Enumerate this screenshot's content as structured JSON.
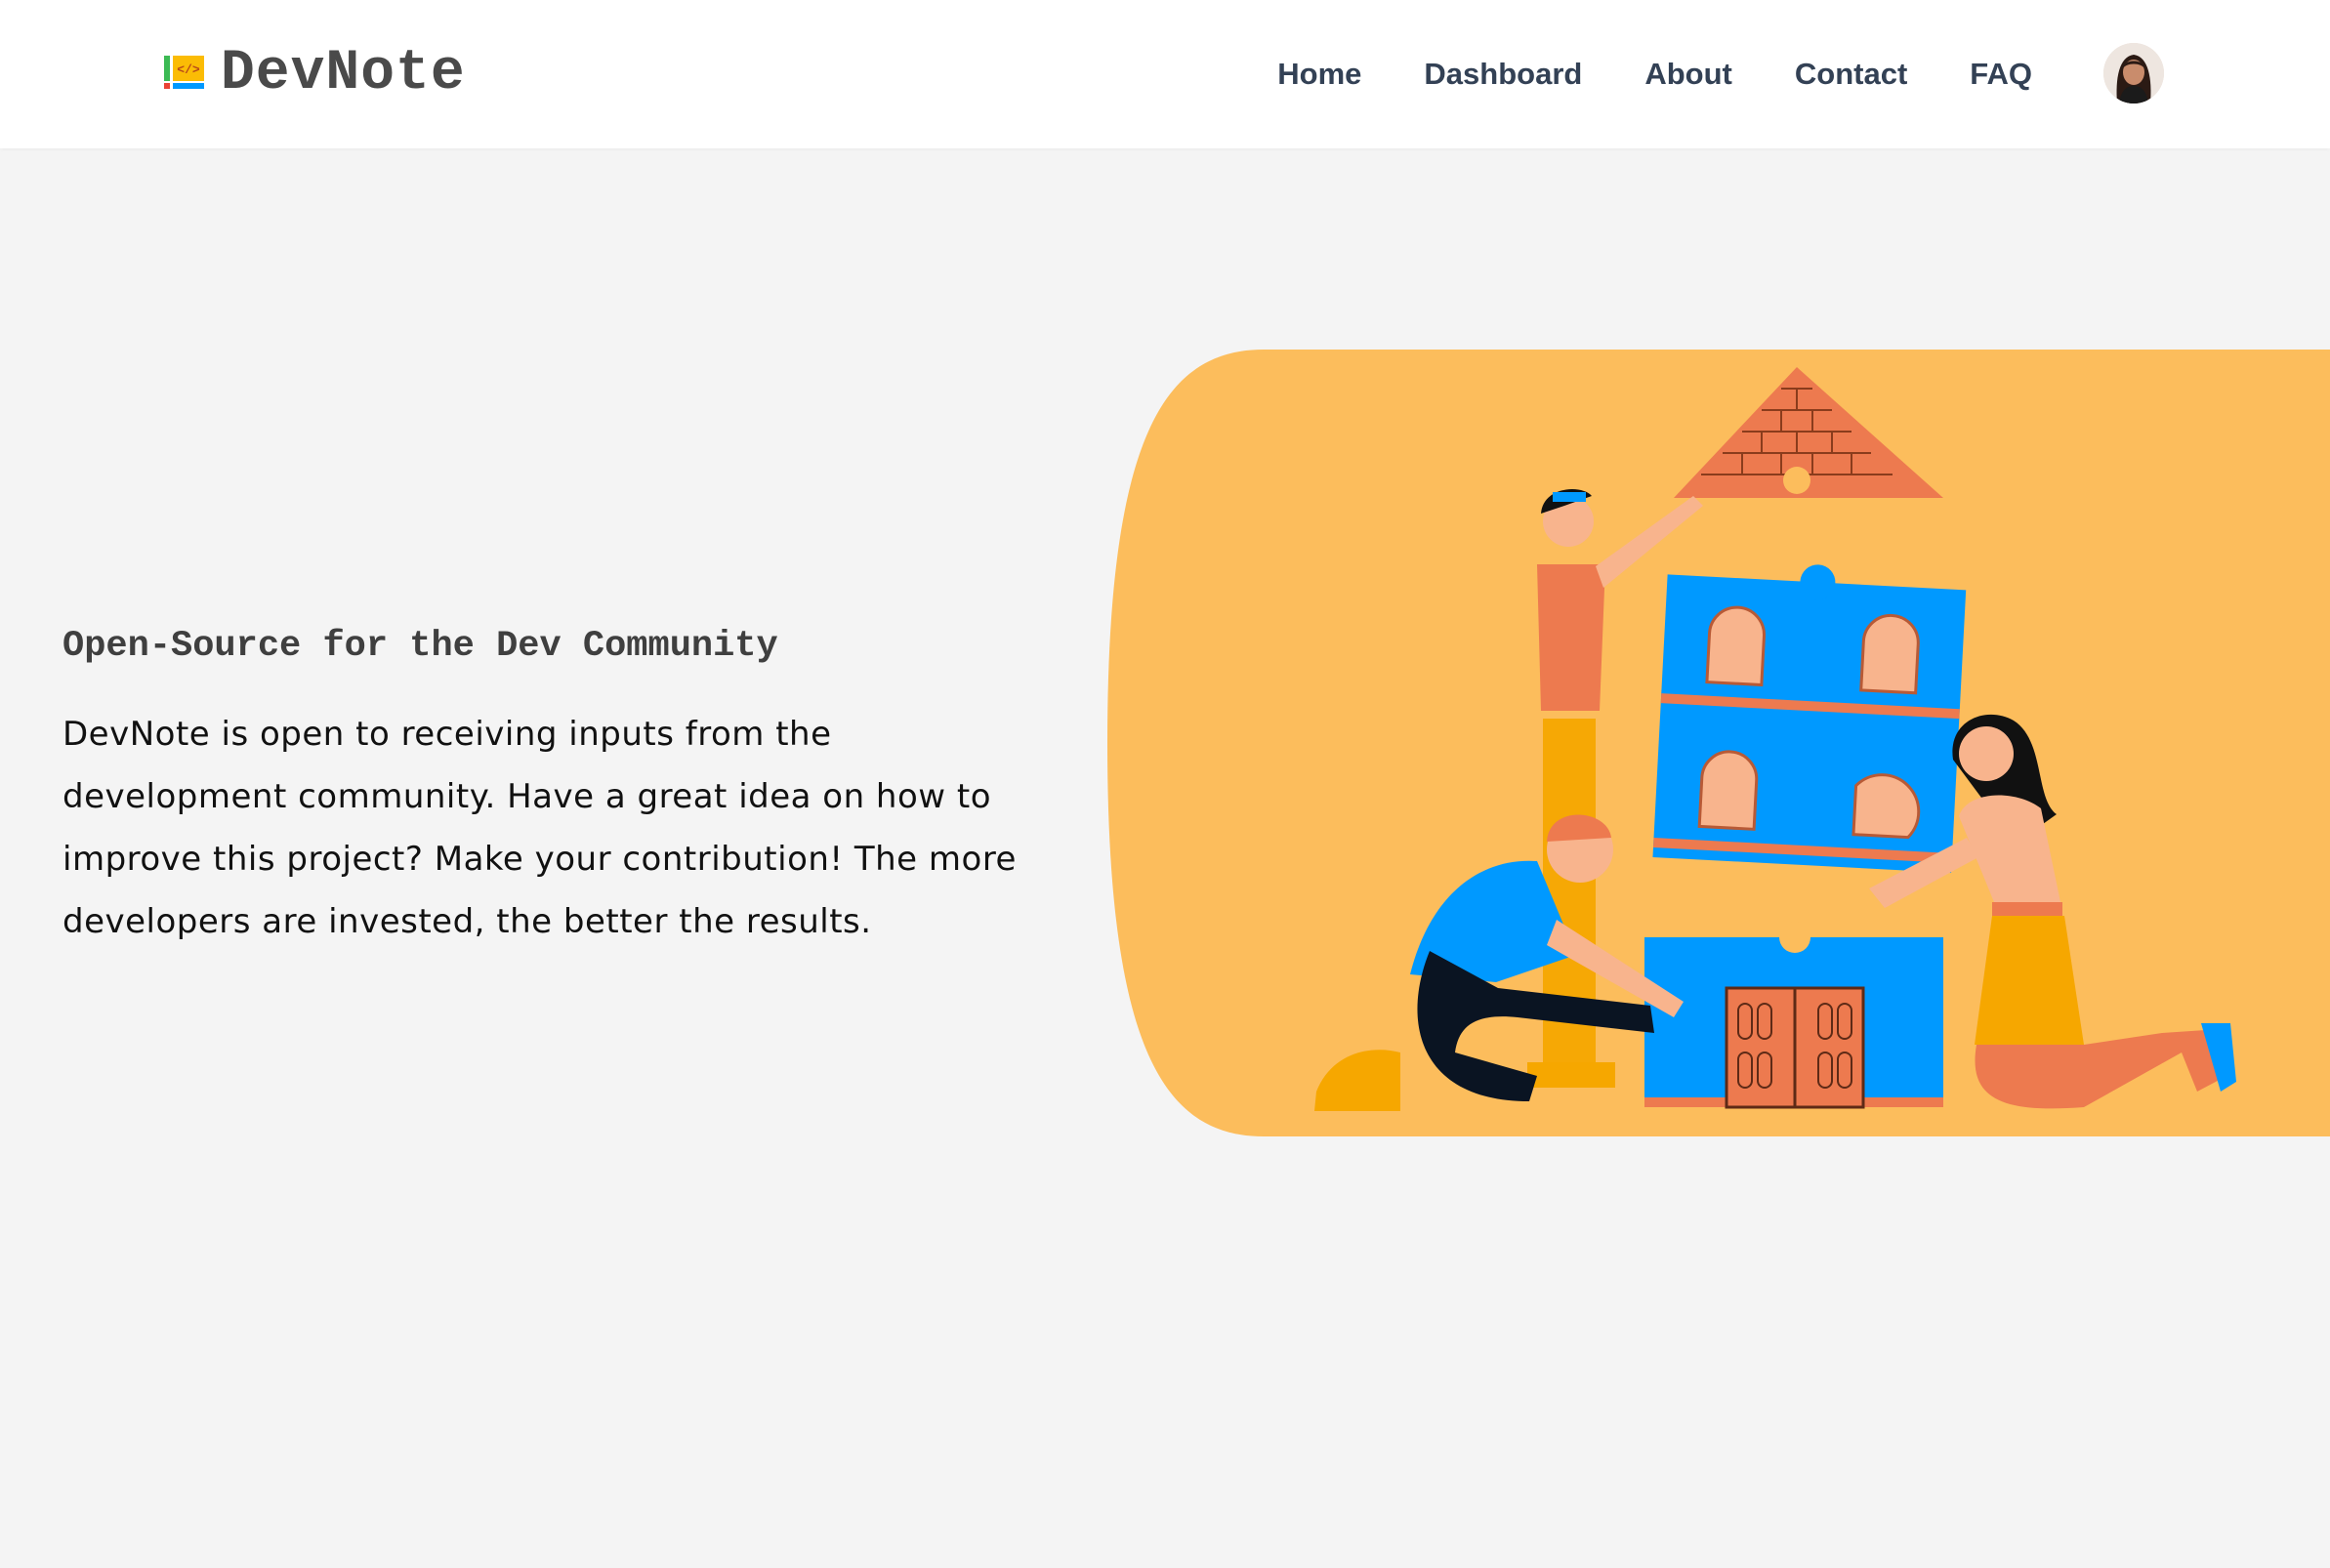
{
  "navbar": {
    "brand": {
      "name": "DevNote",
      "logo_icon": "code-notebook-icon"
    },
    "links": [
      {
        "label": "Home"
      },
      {
        "label": "Dashboard"
      },
      {
        "label": "About"
      },
      {
        "label": "Contact"
      },
      {
        "label": "FAQ"
      }
    ],
    "avatar_icon": "user-avatar"
  },
  "hero": {
    "title": "Open-Source for the Dev Community",
    "body": "DevNote is open to receiving inputs from the development community. Have a great idea on how to improve this project? Make your contribution! The more developers are invested, the better the results.",
    "illustration": "people-building-puzzle-house"
  },
  "colors": {
    "background": "#f4f4f4",
    "navbar": "#ffffff",
    "nav_text": "#334155",
    "illustration_bg": "#fcbd5c",
    "puzzle_blue": "#0099ff",
    "brick": "#ed7a4f"
  }
}
